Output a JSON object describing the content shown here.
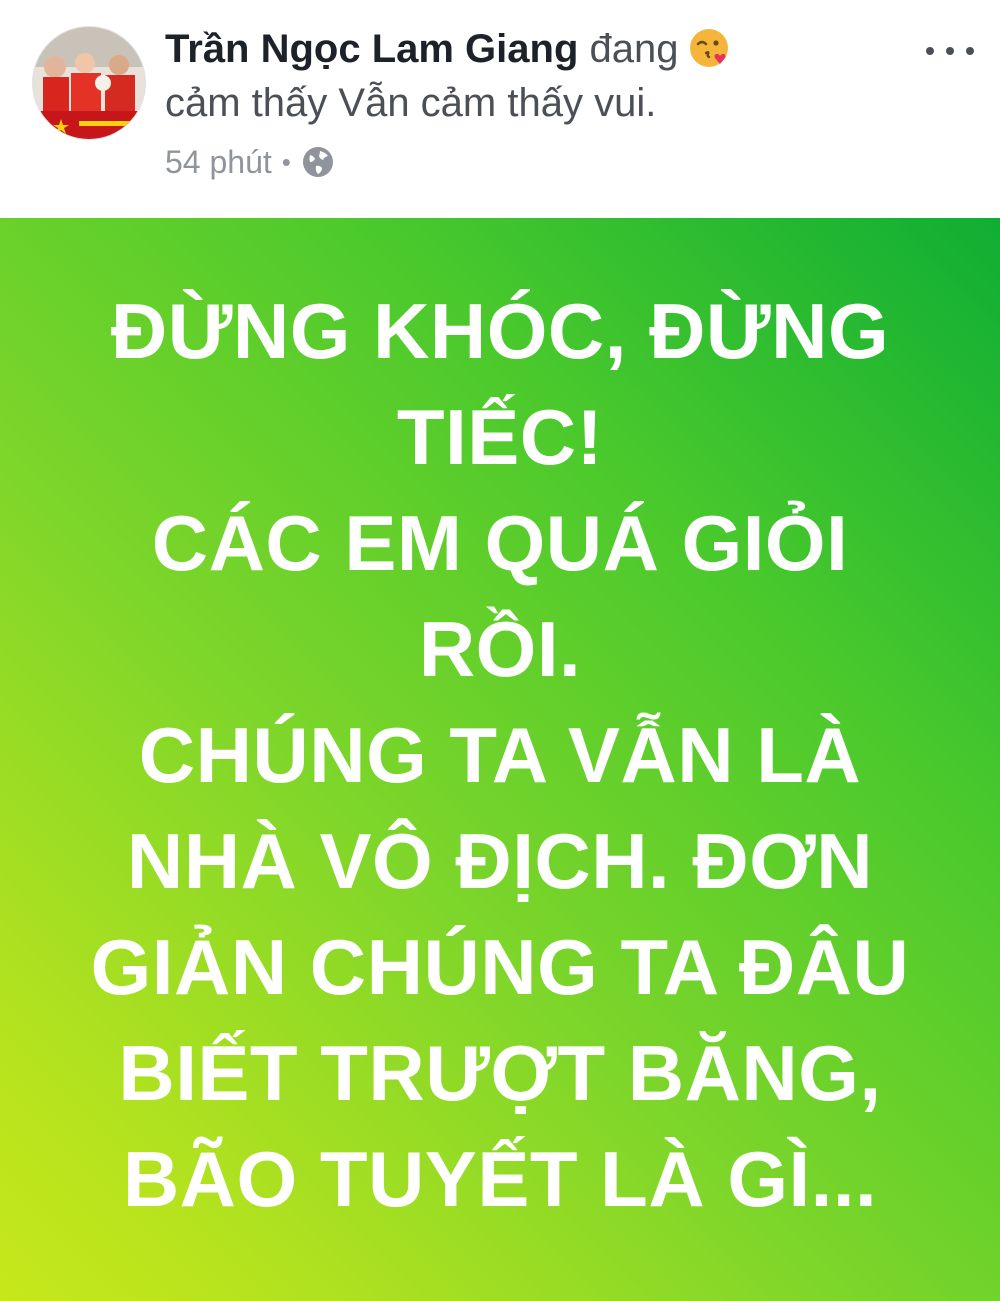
{
  "post": {
    "author_name": "Trần Ngọc Lam Giang",
    "feeling_prefix": "đang",
    "feeling_emoji": "kissing-wink-heart-emoji",
    "feeling_text": "cảm thấy Vẫn cảm thấy vui.",
    "time": "54 phút",
    "separator": "•",
    "privacy_icon": "globe-icon",
    "more_icon": "more-options-icon",
    "status_lines": [
      "ĐỪNG KHÓC, ĐỪNG",
      "TIẾC!",
      "CÁC EM QUÁ GIỎI",
      "RỒI.",
      "CHÚNG TA VẪN LÀ",
      "NHÀ VÔ ĐỊCH. ĐƠN",
      "GIẢN CHÚNG TA ĐÂU",
      "BIẾT TRƯỢT BĂNG,",
      "BÃO TUYẾT LÀ GÌ..."
    ]
  },
  "colors": {
    "status_gradient_start": "#0fae34",
    "status_gradient_end": "#c7e81a",
    "status_text": "#ffffff",
    "author_text": "#1d2129",
    "meta_text": "#90949c"
  }
}
